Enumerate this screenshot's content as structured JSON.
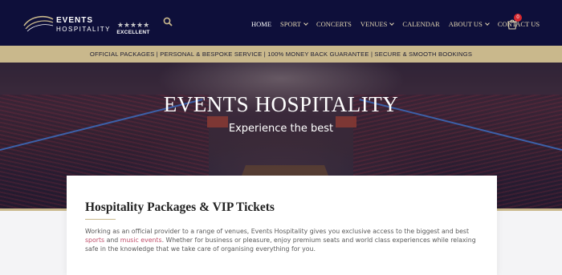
{
  "header": {
    "logo_line1": "EVENTS",
    "logo_line2": "HOSPITALITY",
    "rating_stars": "★★★★★",
    "rating_label": "EXCELLENT",
    "search_icon": "search-icon",
    "cart_icon": "cart-icon",
    "cart_count": "0"
  },
  "nav": {
    "items": [
      {
        "label": "HOME",
        "dropdown": false
      },
      {
        "label": "SPORT",
        "dropdown": true
      },
      {
        "label": "CONCERTS",
        "dropdown": false
      },
      {
        "label": "VENUES",
        "dropdown": true
      },
      {
        "label": "CALENDAR",
        "dropdown": false
      },
      {
        "label": "ABOUT US",
        "dropdown": true
      },
      {
        "label": "CONTACT US",
        "dropdown": false
      }
    ]
  },
  "strip": {
    "text": "OFFICIAL PACKAGES | PERSONAL & BESPOKE SERVICE | 100% MONEY BACK GUARANTEE | SECURE & SMOOTH BOOKINGS"
  },
  "hero": {
    "title": "EVENTS HOSPITALITY",
    "subtitle": "Experience the best"
  },
  "card": {
    "title": "Hospitality Packages & VIP Tickets",
    "body_part1": "Working as an official provider to a range of venues, Events Hospitality gives you exclusive access to the biggest and best ",
    "link_sports": "sports",
    "body_part2": " and ",
    "link_music": "music events",
    "body_part3": ". Whether for business or pleasure, enjoy premium seats and world class experiences while relaxing safe in the knowledge that we take care of organising everything for you."
  },
  "colors": {
    "header_bg": "#0e0f3a",
    "gold": "#c9b88c",
    "nav_text": "#e6d9b5",
    "link": "#c0506b",
    "badge": "#d6282f"
  }
}
